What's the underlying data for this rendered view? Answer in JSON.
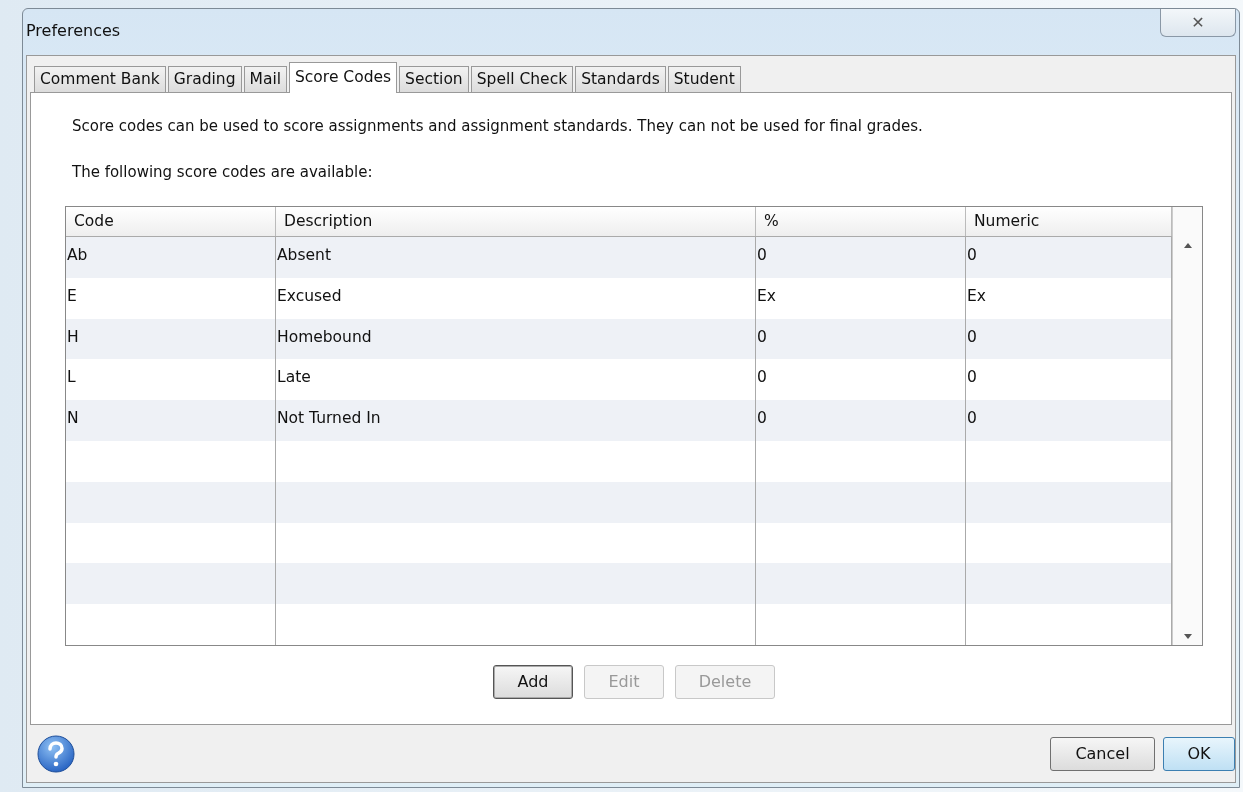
{
  "window": {
    "title": "Preferences",
    "close_label": "✕"
  },
  "tabs": [
    {
      "label": "Comment Bank",
      "selected": false
    },
    {
      "label": "Grading",
      "selected": false
    },
    {
      "label": "Mail",
      "selected": false
    },
    {
      "label": "Score Codes",
      "selected": true
    },
    {
      "label": "Section",
      "selected": false
    },
    {
      "label": "Spell Check",
      "selected": false
    },
    {
      "label": "Standards",
      "selected": false
    },
    {
      "label": "Student",
      "selected": false
    }
  ],
  "intro": "Score codes can be used to score assignments and assignment standards. They can not be used for final grades.",
  "list_label": "The following score codes are available:",
  "table": {
    "columns": [
      "Code",
      "Description",
      "%",
      "Numeric"
    ],
    "rows": [
      [
        "Ab",
        "Absent",
        "0",
        "0"
      ],
      [
        "E",
        "Excused",
        "Ex",
        "Ex"
      ],
      [
        "H",
        "Homebound",
        "0",
        "0"
      ],
      [
        "L",
        "Late",
        "0",
        "0"
      ],
      [
        "N",
        "Not Turned In",
        "0",
        "0"
      ]
    ]
  },
  "actions": [
    {
      "label": "Add",
      "disabled": false,
      "focused": true
    },
    {
      "label": "Edit",
      "disabled": true,
      "focused": false
    },
    {
      "label": "Delete",
      "disabled": true,
      "focused": false
    }
  ],
  "dialog_buttons": [
    {
      "label": "Cancel",
      "default": false
    },
    {
      "label": "OK",
      "default": true
    }
  ]
}
